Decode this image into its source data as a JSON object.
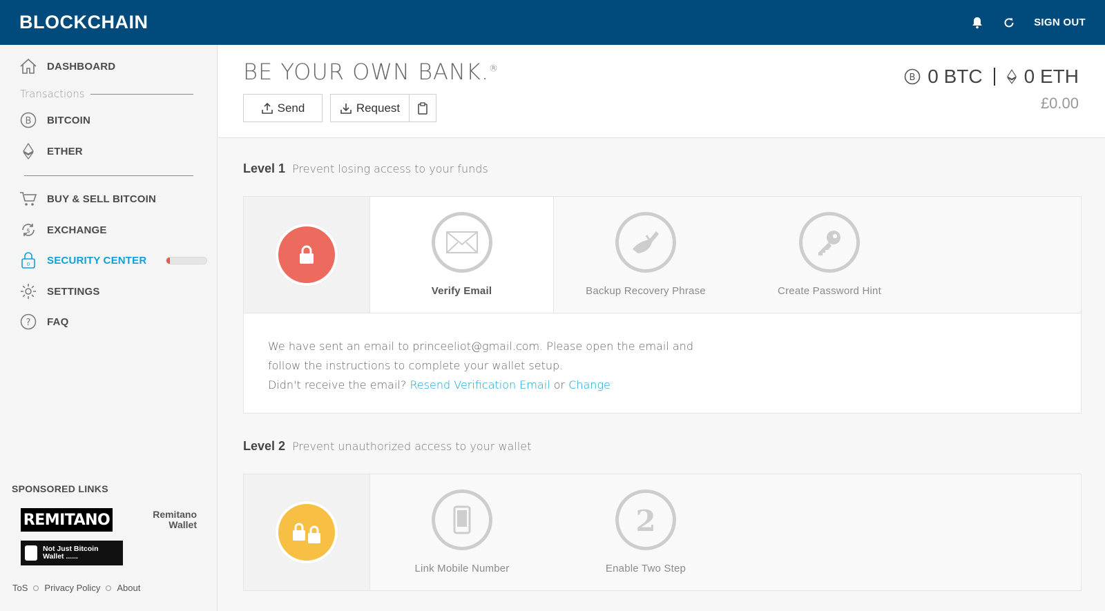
{
  "brand": {
    "logo": "BLOCKCHAIN"
  },
  "topbar": {
    "signout_label": "SIGN OUT",
    "icons": [
      "bell-icon",
      "refresh-icon"
    ]
  },
  "sidebar": {
    "dashboard": "DASHBOARD",
    "transactions_label": "Transactions",
    "bitcoin": "BITCOIN",
    "ether": "ETHER",
    "buy_sell": "BUY & SELL BITCOIN",
    "exchange": "EXCHANGE",
    "security_center": "SECURITY CENTER",
    "security_progress": 0.08,
    "settings": "SETTINGS",
    "faq": "FAQ",
    "sponsored_title": "SPONSORED LINKS",
    "sponsor1_logo": "REMITANO",
    "sponsor1_caption": "Remitano Wallet",
    "sponsor2_text": "Not Just Bitcoin Wallet ......",
    "footer": {
      "tos": "ToS",
      "privacy": "Privacy Policy",
      "about": "About"
    }
  },
  "header": {
    "tagline": "BE YOUR OWN BANK.",
    "tagline_mark": "®",
    "send_label": "Send",
    "request_label": "Request",
    "btc_balance": "0 BTC",
    "eth_balance": "0 ETH",
    "fiat_balance": "£0.00"
  },
  "level1": {
    "title": "Level 1",
    "description": "Prevent losing access to your funds",
    "steps": [
      "Verify Email",
      "Backup Recovery Phrase",
      "Create Password Hint"
    ],
    "message_line1": "We have sent an email to princeeliot@gmail.com. Please open the email and",
    "message_line2": "follow the instructions to complete your wallet setup.",
    "message_line3_prefix": "Didn't receive the email?",
    "resend_link": "Resend Verification Email",
    "or_text": "or",
    "change_link": "Change"
  },
  "level2": {
    "title": "Level 2",
    "description": "Prevent unauthorized access to your wallet",
    "steps": [
      "Link Mobile Number",
      "Enable Two Step"
    ]
  },
  "colors": {
    "topbar": "#004a7c",
    "accent": "#10a0d8",
    "level1_badge": "#ec6b5e",
    "level2_badge": "#f7c044"
  }
}
